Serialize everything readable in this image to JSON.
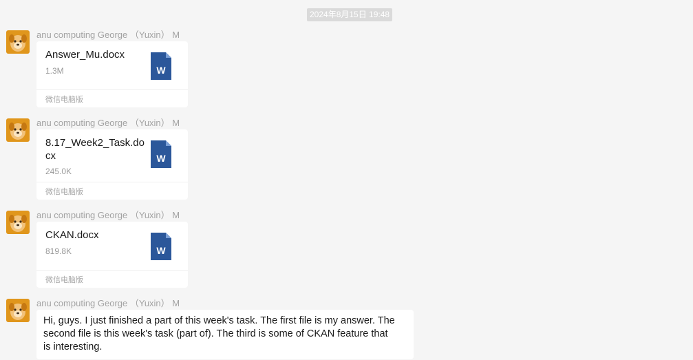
{
  "chat": {
    "timestamp": "2024年8月15日 19:48",
    "messages": [
      {
        "sender": "anu computing George （Yuxin） M",
        "type": "file",
        "file": {
          "name": "Answer_Mu.docx",
          "size": "1.3M",
          "icon": "word-doc-icon",
          "source": "微信电脑版"
        }
      },
      {
        "sender": "anu computing George （Yuxin） M",
        "type": "file",
        "file": {
          "name_lines": [
            "8.17_Week2_Task.do",
            "cx"
          ],
          "size": "245.0K",
          "icon": "word-doc-icon",
          "source": "微信电脑版"
        }
      },
      {
        "sender": "anu computing George （Yuxin） M",
        "type": "file",
        "file": {
          "name": "CKAN.docx",
          "size": "819.8K",
          "icon": "word-doc-icon",
          "source": "微信电脑版"
        }
      },
      {
        "sender": "anu computing George （Yuxin） M",
        "type": "text",
        "text_lines": [
          "Hi, guys. I just finished a part of this week's task. The first file is my answer. The",
          "second file is this week's task (part of). The third is some of CKAN feature that",
          "is interesting."
        ]
      }
    ]
  },
  "colors": {
    "background": "#f5f5f5",
    "bubble": "#ffffff",
    "word_blue": "#2b579a",
    "sender_gray": "#a3a3a3"
  }
}
